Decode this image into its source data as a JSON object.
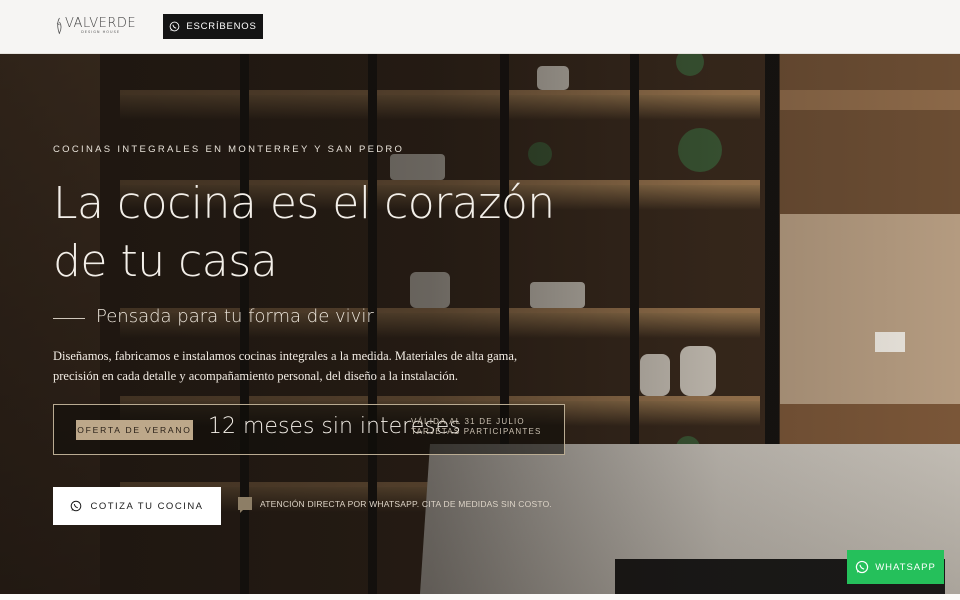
{
  "header": {
    "logo": {
      "name": "VALVERDE",
      "sub": "DESIGN HOUSE"
    },
    "cta_label": "ESCRÍBENOS",
    "cta_icon": "whatsapp-icon"
  },
  "hero": {
    "eyebrow": "COCINAS INTEGRALES EN MONTERREY Y SAN PEDRO",
    "title": "La cocina es el corazón de tu casa",
    "subtitle": "Pensada para tu forma de vivir",
    "description": "Diseñamos, fabricamos e instalamos cocinas integrales a la medida. Materiales de alta gama, precisión en cada detalle y acompañamiento personal, del diseño a la instalación.",
    "offer": {
      "badge": "OFERTA DE VERANO",
      "headline": "12 meses sin intereses",
      "note_line1": "VÁLIDA AL 31 DE JULIO",
      "note_line2": "TARJETAS PARTICIPANTES"
    },
    "primary_cta": {
      "label": "COTIZA TU COCINA",
      "icon": "whatsapp-icon"
    },
    "attention": {
      "icon": "chat-bubble-icon",
      "text": "ATENCIÓN DIRECTA POR WHATSAPP. CITA DE MEDIDAS SIN COSTO."
    }
  },
  "floating": {
    "whatsapp_label": "WHATSAPP",
    "icon": "whatsapp-icon"
  },
  "colors": {
    "accent": "#bda88a",
    "dark_button": "#141414",
    "whatsapp_green": "#25c05b"
  }
}
